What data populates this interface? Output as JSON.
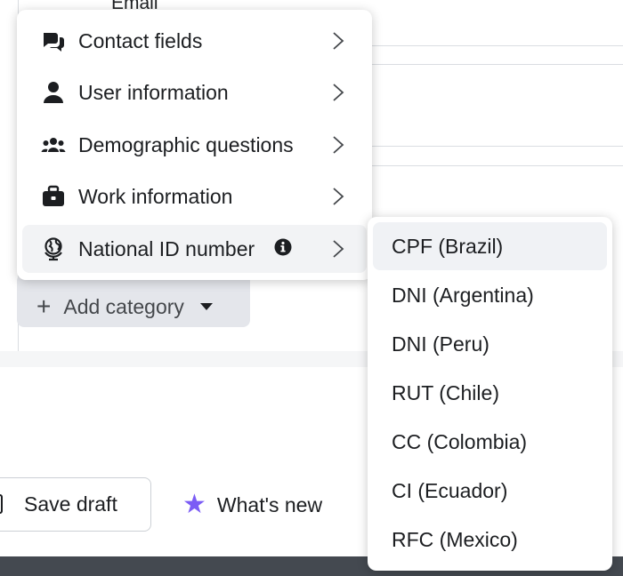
{
  "background": {
    "field_label": "Email",
    "add_category": "Add category",
    "save_draft": "Save draft",
    "whats_new": "What's new"
  },
  "menu": {
    "items": [
      {
        "label": "Contact fields",
        "icon": "chat-bubbles-icon"
      },
      {
        "label": "User information",
        "icon": "person-icon"
      },
      {
        "label": "Demographic questions",
        "icon": "group-icon"
      },
      {
        "label": "Work information",
        "icon": "briefcase-icon"
      },
      {
        "label": "National ID number",
        "icon": "globe-icon",
        "has_info": true,
        "active": true
      }
    ]
  },
  "submenu": {
    "items": [
      {
        "label": "CPF (Brazil)",
        "active": true
      },
      {
        "label": "DNI (Argentina)"
      },
      {
        "label": "DNI (Peru)"
      },
      {
        "label": "RUT (Chile)"
      },
      {
        "label": "CC (Colombia)"
      },
      {
        "label": "CI (Ecuador)"
      },
      {
        "label": "RFC (Mexico)"
      }
    ]
  },
  "colors": {
    "accent_star": "#7b5cf5",
    "active_row": "#f2f3f5",
    "add_category_bg": "#e4e6eb"
  }
}
